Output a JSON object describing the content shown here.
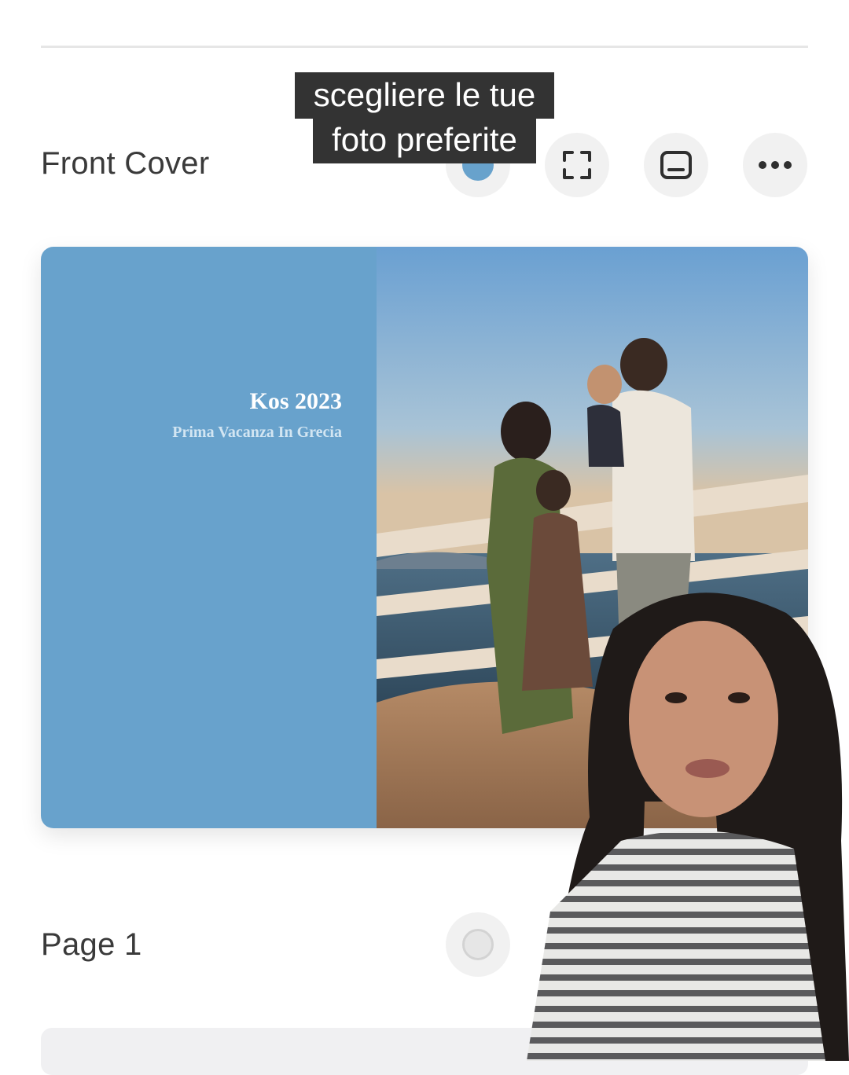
{
  "caption": {
    "line1": "scegliere le tue",
    "line2": "foto preferite"
  },
  "front_cover": {
    "section_title": "Front Cover",
    "cover_title": "Kos 2023",
    "cover_subtitle": "Prima Vacanza In Grecia",
    "background_color": "#68a2cc",
    "tools": [
      {
        "name": "background-color",
        "icon": "color-dot-icon",
        "color": "#68a2cc"
      },
      {
        "name": "fullscreen",
        "icon": "fullscreen-icon"
      },
      {
        "name": "layout",
        "icon": "layout-icon"
      },
      {
        "name": "more-options",
        "icon": "more-horizontal-icon"
      }
    ]
  },
  "page1": {
    "section_title": "Page 1",
    "tools": [
      {
        "name": "background-color",
        "icon": "color-dot-icon",
        "color": "#e6e6e6"
      }
    ]
  }
}
